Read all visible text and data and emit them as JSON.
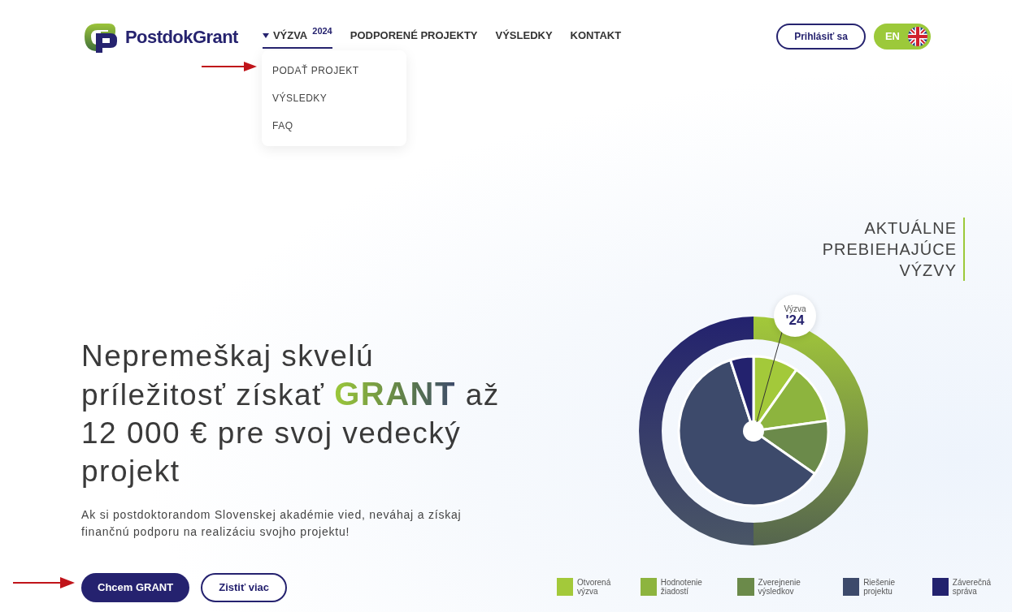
{
  "header": {
    "logo_text": "PostdokGrant",
    "nav": [
      {
        "label": "VÝZVA",
        "sup": "2024",
        "dropdown": true,
        "selected": true
      },
      {
        "label": "PODPORENÉ PROJEKTY",
        "selected": false
      },
      {
        "label": "VÝSLEDKY",
        "selected": false
      },
      {
        "label": "KONTAKT",
        "selected": false
      }
    ],
    "dropdown_items": [
      "PODAŤ PROJEKT",
      "VÝSLEDKY",
      "FAQ"
    ],
    "login_button": "Prihlásiť sa",
    "language_button": "EN"
  },
  "hero": {
    "headline": {
      "before": "Nepremeškaj skvelú príležitosť získať ",
      "highlight": "GRANT",
      "after": " až 12 000 € pre svoj vedecký projekt"
    },
    "text": "Ak si postdoktorandom Slovenskej akadémie vied, neváhaj a získaj finančnú podporu na realizáciu svojho projektu!",
    "buttons": [
      {
        "label": "Chcem GRANT",
        "kind": "primary"
      },
      {
        "label": "Zistiť viac",
        "kind": "outline"
      }
    ]
  },
  "calls_panel": {
    "title": [
      "AKTUÁLNE",
      "PREBIEHAJÚCE",
      "VÝZVY"
    ],
    "badge": {
      "label": "Výzva",
      "year": "'24"
    },
    "legend": [
      {
        "label": "Otvorená výzva",
        "color": "#a3c93a"
      },
      {
        "label": "Hodnotenie žiadostí",
        "color": "#8db43e"
      },
      {
        "label": "Zverejnenie výsledkov",
        "color": "#6b8a4a"
      },
      {
        "label": "Riešenie projektu",
        "color": "#3d4a6b"
      },
      {
        "label": "Záverečná správa",
        "color": "#23226e"
      }
    ]
  }
}
